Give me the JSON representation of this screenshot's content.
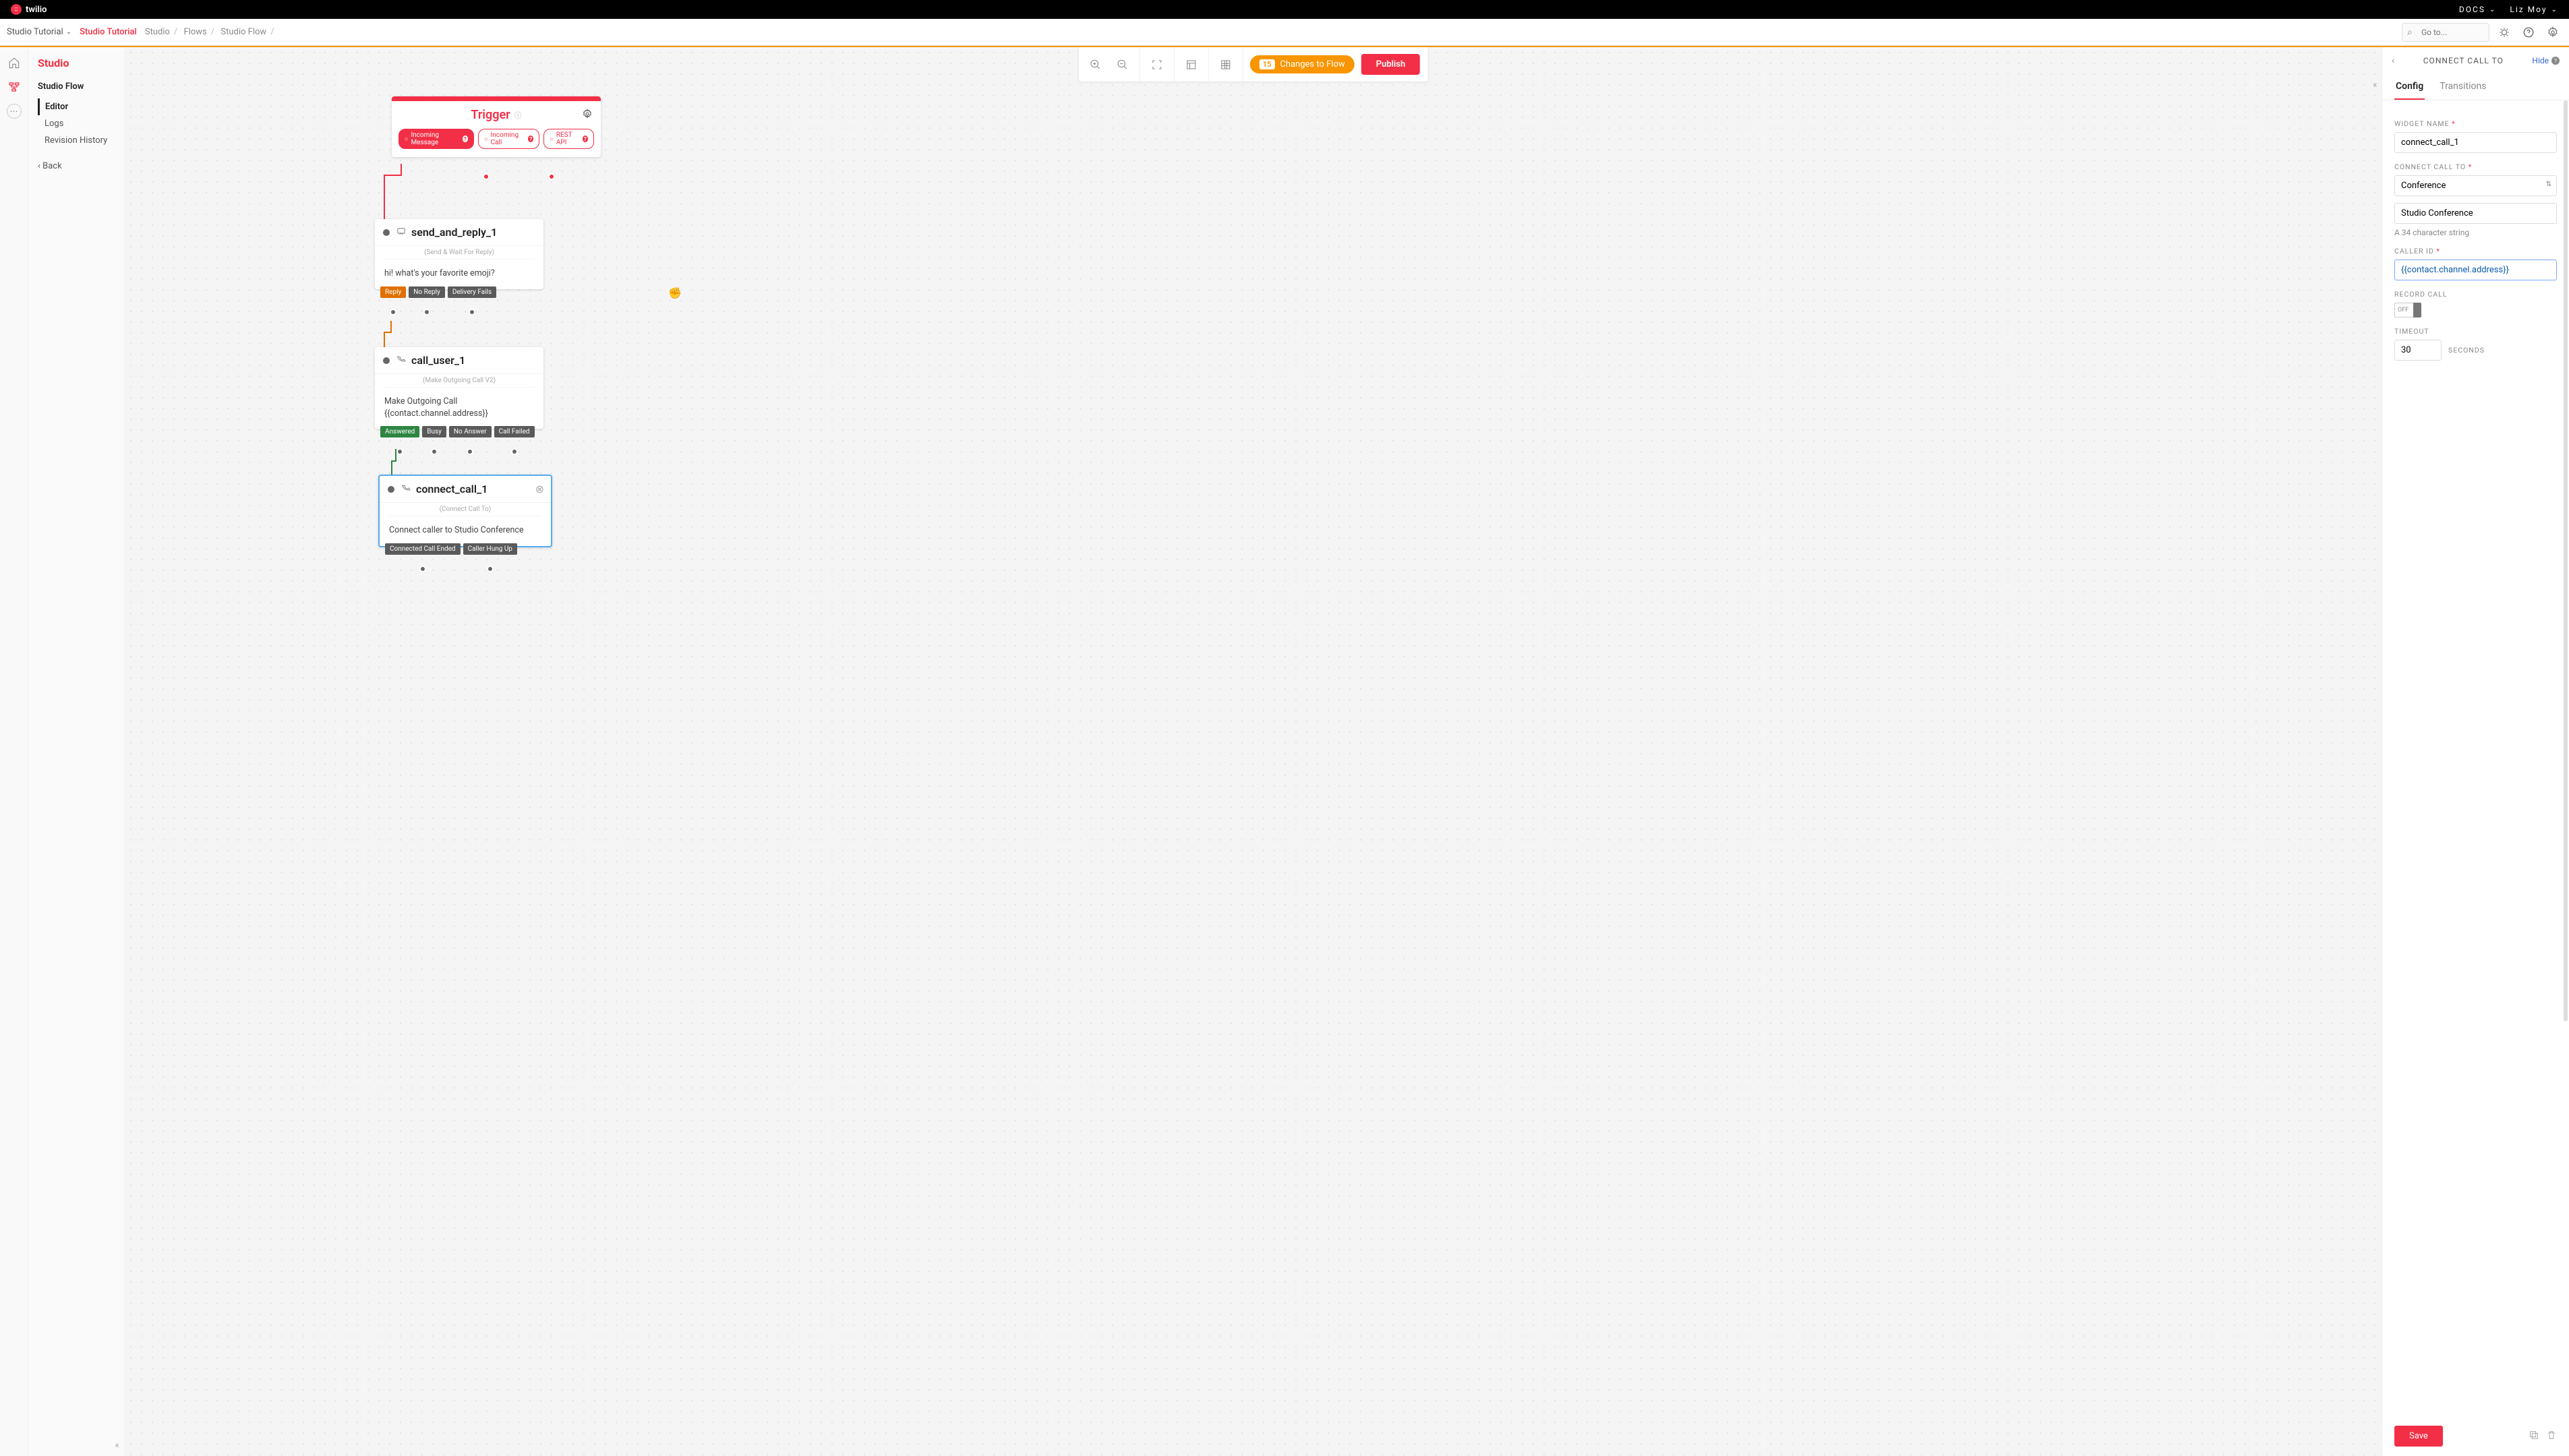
{
  "topHeader": {
    "logoText": "twilio",
    "docs": "DOCS",
    "user": "Liz Moy"
  },
  "subHeader": {
    "appName": "Studio Tutorial",
    "context": "Studio Tutorial",
    "crumbs": [
      "Studio",
      "Flows",
      "Studio Flow"
    ],
    "searchPlaceholder": "Go to..."
  },
  "sidebar": {
    "title": "Studio",
    "section": "Studio Flow",
    "items": [
      "Editor",
      "Logs",
      "Revision History"
    ],
    "back": "Back"
  },
  "toolbar": {
    "changesCount": "15",
    "changesLabel": "Changes to Flow",
    "publish": "Publish"
  },
  "trigger": {
    "title": "Trigger",
    "chips": [
      "Incoming Message",
      "Incoming Call",
      "REST API"
    ]
  },
  "widget1": {
    "title": "send_and_reply_1",
    "subtitle": "(Send & Wait For Reply)",
    "body": "hi! what's your favorite emoji?",
    "outs": [
      "Reply",
      "No Reply",
      "Delivery Fails"
    ]
  },
  "widget2": {
    "title": "call_user_1",
    "subtitle": "(Make Outgoing Call V2)",
    "bodyLine1": "Make Outgoing Call",
    "bodyLine2": "{{contact.channel.address}}",
    "outs": [
      "Answered",
      "Busy",
      "No Answer",
      "Call Failed"
    ]
  },
  "widget3": {
    "title": "connect_call_1",
    "subtitle": "(Connect Call To)",
    "body": "Connect caller to Studio Conference",
    "outs": [
      "Connected Call Ended",
      "Caller Hung Up"
    ]
  },
  "panel": {
    "title": "CONNECT CALL TO",
    "hide": "Hide",
    "tabs": [
      "Config",
      "Transitions"
    ],
    "labels": {
      "widgetName": "WIDGET NAME",
      "connectTo": "CONNECT CALL TO",
      "callerId": "CALLER ID",
      "recordCall": "RECORD CALL",
      "timeout": "TIMEOUT",
      "seconds": "SECONDS"
    },
    "values": {
      "widgetName": "connect_call_1",
      "connectTo": "Conference",
      "conferenceName": "Studio Conference",
      "conferenceHint": "A 34 character string",
      "callerId": "{{contact.channel.address}}",
      "recordCall": "OFF",
      "timeout": "30"
    },
    "save": "Save"
  }
}
